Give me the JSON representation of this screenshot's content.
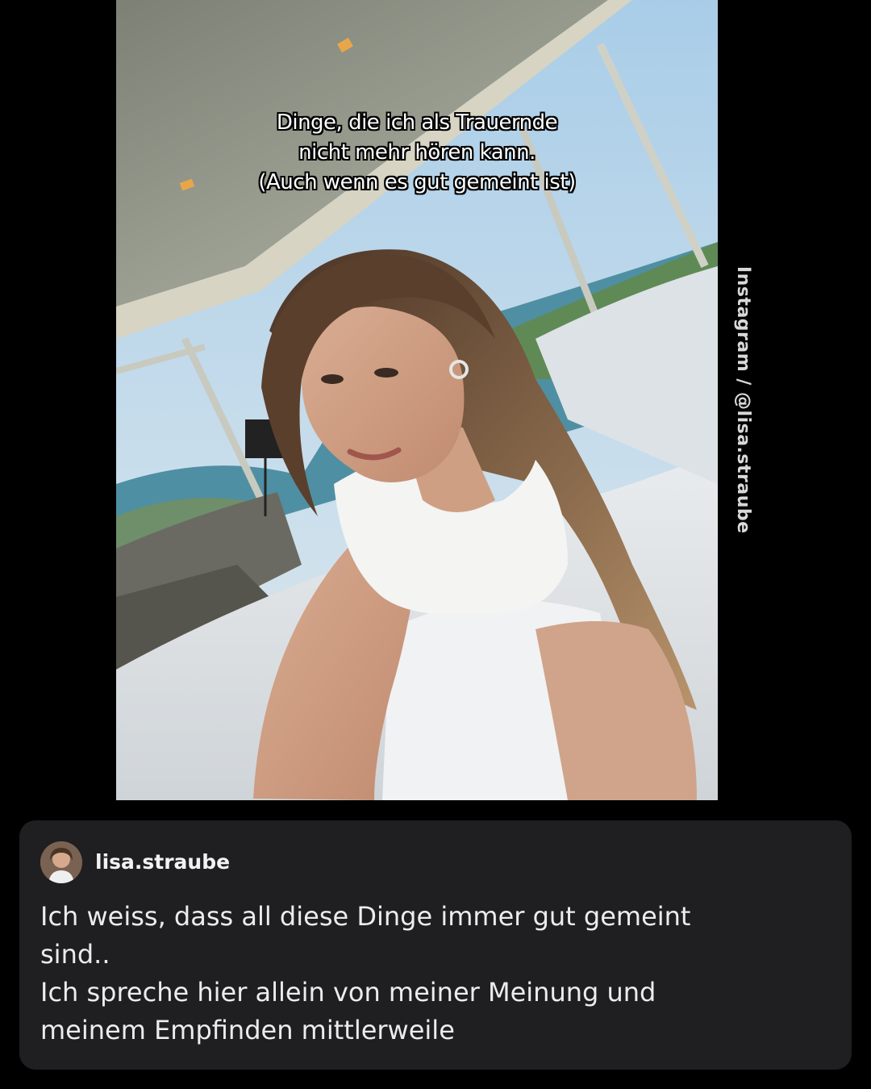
{
  "post": {
    "overlay_lines": [
      "Dinge, die ich als Trauernde",
      "nicht mehr hören kann.",
      "(Auch wenn es gut gemeint ist)"
    ],
    "credit": "Instagram / @lisa.straube"
  },
  "caption_card": {
    "username": "lisa.straube",
    "avatar_icon": "profile-avatar",
    "text_lines": [
      "Ich weiss, dass all diese Dinge immer gut gemeint",
      "sind..",
      "Ich spreche hier allein von meiner Meinung und",
      "meinem Empfinden mittlerweile"
    ]
  },
  "colors": {
    "background": "#000000",
    "card": "#1f1f21",
    "text": "#ececec"
  }
}
